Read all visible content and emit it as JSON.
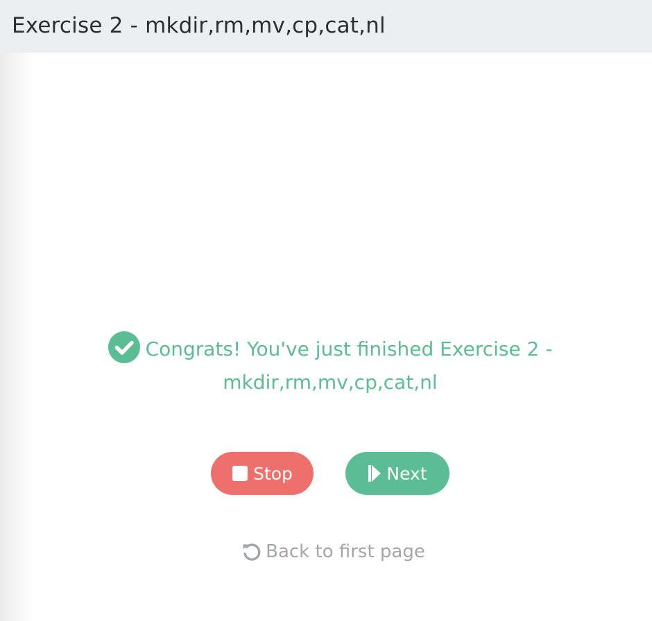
{
  "header": {
    "title": "Exercise 2 - mkdir,rm,mv,cp,cat,nl"
  },
  "result": {
    "message": "Congrats! You've just finished Exercise 2 - mkdir,rm,mv,cp,cat,nl",
    "icon": "check-circle-icon"
  },
  "actions": {
    "stop_label": "Stop",
    "stop_icon": "stop-icon",
    "next_label": "Next",
    "next_icon": "step-forward-icon"
  },
  "back": {
    "label": "Back to first page",
    "icon": "undo-icon"
  },
  "colors": {
    "success": "#5bbd93",
    "danger": "#ef6f6c",
    "muted": "#a3a6a9",
    "header_bg": "#eceef0"
  }
}
